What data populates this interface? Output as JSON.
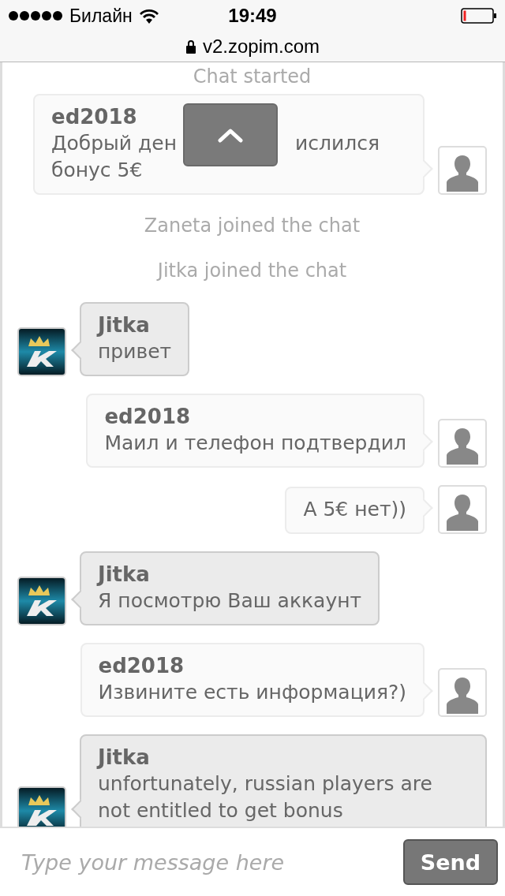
{
  "status_bar": {
    "carrier": "Билайн",
    "time": "19:49"
  },
  "address_bar": {
    "url": "v2.zopim.com"
  },
  "chat": [
    {
      "kind": "system",
      "text": "Chat started"
    },
    {
      "kind": "visitor",
      "name": "ed2018",
      "text_before_overlay": "Добрый ден",
      "text_after_overlay": "ислился бонус 5€"
    },
    {
      "kind": "system",
      "text": "Zaneta joined the chat"
    },
    {
      "kind": "system",
      "text": "Jitka joined the chat"
    },
    {
      "kind": "agent",
      "name": "Jitka",
      "text": "привет"
    },
    {
      "kind": "visitor",
      "name": "ed2018",
      "text": "Маил и телефон подтвердил"
    },
    {
      "kind": "visitor",
      "text": "А 5€ нет))"
    },
    {
      "kind": "agent",
      "name": "Jitka",
      "text": "Я посмотрю Ваш аккаунт"
    },
    {
      "kind": "visitor",
      "name": "ed2018",
      "text": "Извините есть информация?)"
    },
    {
      "kind": "agent",
      "name": "Jitka",
      "text": "unfortunately, russian players are not entitled to get bonus"
    }
  ],
  "composer": {
    "placeholder": "Type your message here",
    "send_label": "Send"
  }
}
